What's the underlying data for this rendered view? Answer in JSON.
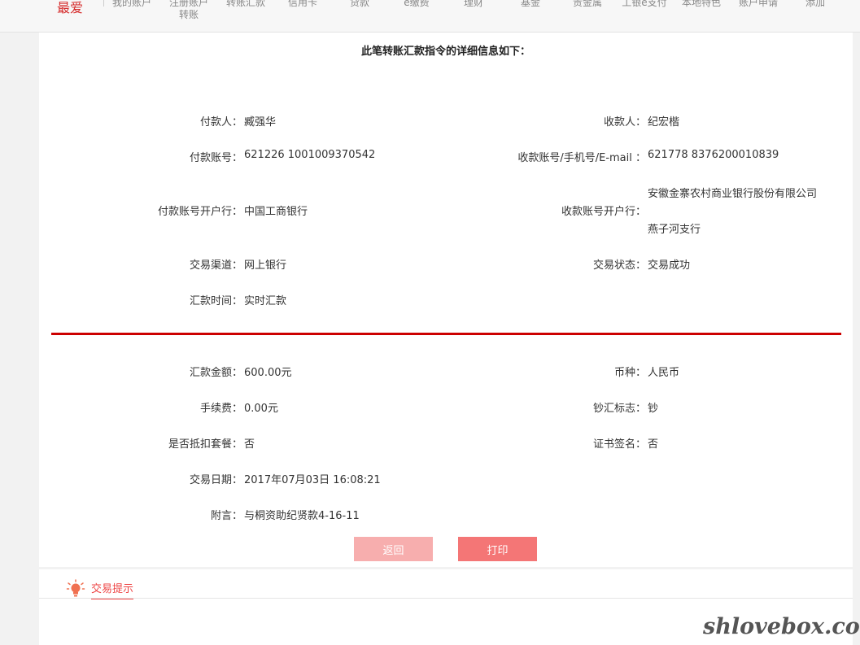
{
  "nav": {
    "favorites": "最爱",
    "items": [
      {
        "label": "我的账户"
      },
      {
        "label": "注册账户\n转账"
      },
      {
        "label": "转账汇款"
      },
      {
        "label": "信用卡"
      },
      {
        "label": "贷款"
      },
      {
        "label": "e缴费"
      },
      {
        "label": "理财"
      },
      {
        "label": "基金"
      },
      {
        "label": "贵金属"
      },
      {
        "label": "工银e支付"
      },
      {
        "label": "本地特色"
      },
      {
        "label": "账户申请"
      },
      {
        "label": "添加"
      }
    ]
  },
  "detail": {
    "title": "此笔转账汇款指令的详细信息如下：",
    "payer_label": "付款人：",
    "payer_value": "臧强华",
    "payee_label": "收款人：",
    "payee_value": "纪宏楷",
    "payer_account_label": "付款账号：",
    "payer_account_value": "621226 1001009370542",
    "payee_account_label": "收款账号/手机号/E-mail ：",
    "payee_account_value": "621778 8376200010839",
    "payer_bank_label": "付款账号开户行：",
    "payer_bank_value": "中国工商银行",
    "payee_bank_label": "收款账号开户行：",
    "payee_bank_line1": "安徽金寨农村商业银行股份有限公司",
    "payee_bank_line2": "燕子河支行",
    "channel_label": "交易渠道：",
    "channel_value": "网上银行",
    "status_label": "交易状态：",
    "status_value": "交易成功",
    "remit_time_label": "汇款时间：",
    "remit_time_value": "实时汇款"
  },
  "amount": {
    "amount_label": "汇款金额：",
    "amount_value": "600.00元",
    "currency_label": "币种：",
    "currency_value": "人民币",
    "fee_label": "手续费：",
    "fee_value": "0.00元",
    "cash_flag_label": "钞汇标志：",
    "cash_flag_value": "钞",
    "package_label": "是否抵扣套餐：",
    "package_value": "否",
    "cert_label": "证书签名：",
    "cert_value": "否",
    "date_label": "交易日期：",
    "date_value": "2017年07月03日 16:08:21",
    "note_label": "附言：",
    "note_value": "与桐资助纪贤款4-16-11"
  },
  "buttons": {
    "back": "返回",
    "print": "打印"
  },
  "tips": {
    "label": "交易提示",
    "icon": "lightbulb-icon"
  },
  "watermark": "shlovebox.com",
  "colors": {
    "accent": "#cc0000",
    "back_button": "#f7aeae",
    "print_button": "#f47676"
  }
}
